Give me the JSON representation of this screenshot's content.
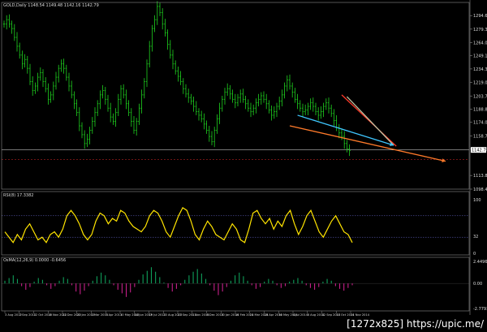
{
  "chart_data": {
    "type": "line",
    "header": "GOLD,Daily  1148.54 1149.48 1142.16 1142.79",
    "price": {
      "series_name": "",
      "ylim": [
        1098.44,
        1309.5
      ],
      "ticks": [
        "1294.64",
        "1279.34",
        "1264.04",
        "1249.19",
        "1234.34",
        "1219.04",
        "1203.74",
        "1188.89",
        "1174.04",
        "1158.74",
        "1143.89",
        "1113.89",
        "1098.44"
      ],
      "tick_values": [
        1294.64,
        1279.34,
        1264.04,
        1249.19,
        1234.34,
        1219.04,
        1203.74,
        1188.89,
        1174.04,
        1158.74,
        1143.89,
        1113.89,
        1098.44
      ],
      "current_price": "1142.79",
      "current_value": 1142.79,
      "resistance_level": 1132.0,
      "values": [
        1285,
        1290,
        1285,
        1280,
        1270,
        1260,
        1250,
        1240,
        1245,
        1235,
        1220,
        1210,
        1215,
        1225,
        1230,
        1220,
        1212,
        1200,
        1205,
        1215,
        1225,
        1235,
        1240,
        1235,
        1225,
        1215,
        1205,
        1195,
        1185,
        1170,
        1160,
        1150,
        1155,
        1165,
        1175,
        1185,
        1195,
        1205,
        1210,
        1200,
        1190,
        1180,
        1175,
        1185,
        1200,
        1212,
        1205,
        1195,
        1185,
        1175,
        1165,
        1175,
        1190,
        1205,
        1220,
        1240,
        1260,
        1280,
        1290,
        1305,
        1298,
        1285,
        1275,
        1262,
        1250,
        1240,
        1232,
        1226,
        1220,
        1212,
        1206,
        1202,
        1198,
        1192,
        1186,
        1182,
        1178,
        1172,
        1165,
        1158,
        1152,
        1165,
        1178,
        1190,
        1200,
        1208,
        1212,
        1206,
        1200,
        1196,
        1202,
        1206,
        1200,
        1195,
        1190,
        1186,
        1190,
        1196,
        1200,
        1204,
        1200,
        1195,
        1188,
        1182,
        1186,
        1192,
        1198,
        1205,
        1215,
        1222,
        1215,
        1208,
        1200,
        1195,
        1190,
        1186,
        1188,
        1192,
        1196,
        1192,
        1186,
        1182,
        1186,
        1192,
        1196,
        1190,
        1184,
        1176,
        1168,
        1162,
        1158,
        1150,
        1144,
        1142
      ]
    },
    "rsi": {
      "label": "RSI(8) 17.3382",
      "ylim": [
        0,
        100
      ],
      "ticks": [
        "100",
        "32",
        "0"
      ],
      "tick_values": [
        100,
        32,
        0
      ],
      "levels": [
        70,
        30
      ],
      "values": [
        40,
        30,
        20,
        35,
        25,
        45,
        55,
        40,
        25,
        30,
        20,
        35,
        40,
        30,
        45,
        70,
        80,
        70,
        55,
        35,
        25,
        35,
        60,
        75,
        70,
        55,
        65,
        60,
        80,
        75,
        60,
        50,
        45,
        40,
        50,
        70,
        80,
        75,
        60,
        40,
        30,
        50,
        70,
        85,
        80,
        60,
        35,
        25,
        45,
        60,
        50,
        35,
        30,
        25,
        40,
        55,
        45,
        25,
        20,
        45,
        75,
        80,
        65,
        55,
        65,
        45,
        60,
        50,
        70,
        80,
        55,
        35,
        50,
        70,
        80,
        60,
        40,
        30,
        45,
        60,
        70,
        55,
        40,
        35,
        20
      ]
    },
    "osma": {
      "label": "OsMA(12,26,9) 0.0000 -0.6456",
      "ylim": [
        -2.7793,
        2.4496
      ],
      "ticks": [
        "2.4496",
        "0.00",
        "-2.7793"
      ],
      "tick_values": [
        2.4496,
        0.0,
        -2.7793
      ],
      "values": [
        0.3,
        0.6,
        0.9,
        0.5,
        -0.3,
        -0.7,
        -0.4,
        0.2,
        0.6,
        0.4,
        -0.2,
        -0.6,
        -0.3,
        0.3,
        0.7,
        0.5,
        -0.2,
        -0.9,
        -1.2,
        -0.8,
        -0.3,
        0.3,
        0.8,
        1.2,
        0.9,
        0.4,
        -0.2,
        -0.7,
        -1.1,
        -1.5,
        -1.0,
        -0.4,
        0.4,
        1.0,
        1.4,
        1.8,
        1.3,
        0.7,
        0.1,
        -0.5,
        -0.9,
        -0.6,
        -0.2,
        0.4,
        0.9,
        1.3,
        1.6,
        1.1,
        0.5,
        -0.2,
        -0.8,
        -1.3,
        -0.9,
        -0.4,
        0.3,
        0.9,
        1.2,
        0.8,
        0.3,
        -0.2,
        -0.6,
        -0.4,
        0.2,
        0.5,
        0.3,
        -0.2,
        -0.5,
        -0.3,
        0.2,
        0.4,
        0.6,
        0.3,
        -0.2,
        -0.5,
        -0.7,
        -0.4,
        0.2,
        0.5,
        0.3,
        -0.3,
        -0.6,
        -0.8,
        -0.5,
        -0.2
      ]
    },
    "dates": [
      "3 Aug 2012",
      "7 Sep 2012",
      "12 Oct 2012",
      "16 Nov 2012",
      "21 Dec 2012",
      "25 Jan 2013",
      "1 Mar 2013",
      "5 Apr 2013",
      "10 May 2013",
      "14 Jun 2013",
      "19 Jul 2013",
      "23 Aug 2013",
      "27 Sep 2013",
      "1 Nov 2013",
      "6 Dec 2013",
      "10 Jan 2014",
      "14 Feb 2014",
      "21 Mar 2014",
      "25 Apr 2014",
      "30 May 2014",
      "4 Jul 2014",
      "8 Aug 2014",
      "12 Sep 2014",
      "17 Oct 2014",
      "21 Nov 2014"
    ],
    "trendlines": [
      {
        "color": "#ff3a2a",
        "from": [
          130,
          1205
        ],
        "to": [
          151,
          1147
        ]
      },
      {
        "color": "#c0c0a0",
        "from": [
          132,
          1203
        ],
        "to": [
          150,
          1148
        ]
      },
      {
        "color": "#3fc6ff",
        "from": [
          113,
          1182
        ],
        "to": [
          150,
          1148
        ]
      },
      {
        "color": "#ff7a2a",
        "from": [
          110,
          1170
        ],
        "to": [
          170,
          1130
        ]
      }
    ]
  },
  "watermark": "[1272x825] https://upic.me/"
}
